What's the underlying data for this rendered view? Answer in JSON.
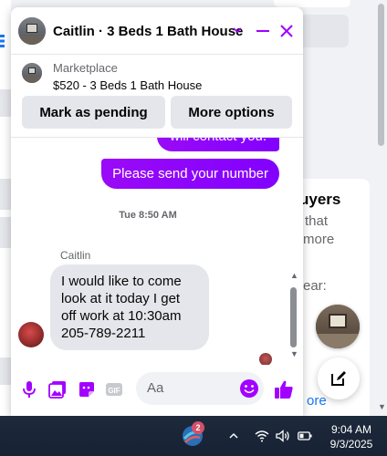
{
  "background": {
    "heading_fragment": "uyers",
    "text_fragment_1": "that",
    "text_fragment_2": "more",
    "text_fragment_3": "ear:",
    "link_fragment": "ore"
  },
  "chat": {
    "title": "Caitlin · 3 Beds 1 Bath House",
    "listing": {
      "source": "Marketplace",
      "title": "$520 - 3 Beds 1 Bath House"
    },
    "buttons": {
      "mark_pending": "Mark as pending",
      "more_options": "More options"
    },
    "messages": {
      "outgoing_partial": "will contact you.",
      "outgoing": "Please send your number",
      "timestamp": "Tue 8:50 AM",
      "sender_name": "Caitlin",
      "incoming": "I would like to come look at it today I get off work at 10:30am 205-789-2211"
    },
    "composer": {
      "placeholder": "Aa"
    },
    "colors": {
      "accent": "#a200ff",
      "outgoing_bubble": "#8a00ff",
      "incoming_bubble": "#e4e6eb"
    }
  },
  "taskbar": {
    "app_badge": "2",
    "time": "9:04 AM",
    "date": "9/3/2025"
  }
}
